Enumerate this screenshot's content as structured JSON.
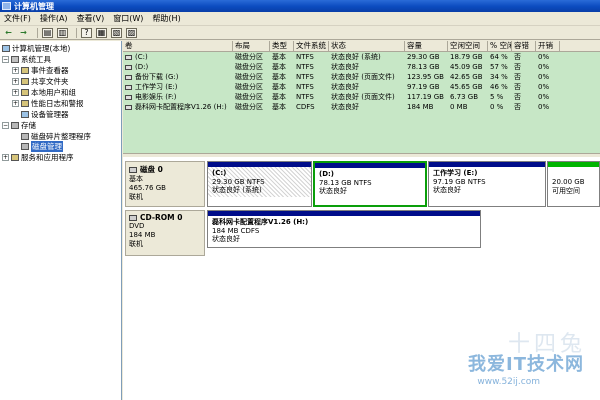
{
  "window": {
    "title": "计算机管理"
  },
  "menu": [
    "文件(F)",
    "操作(A)",
    "查看(V)",
    "窗口(W)",
    "帮助(H)"
  ],
  "tree": {
    "root": "计算机管理(本地)",
    "system_tools": "系统工具",
    "event_viewer": "事件查看器",
    "shared_folders": "共享文件夹",
    "local_users": "本地用户和组",
    "perf_logs": "性能日志和警报",
    "device_manager": "设备管理器",
    "storage": "存储",
    "defrag": "磁盘碎片整理程序",
    "disk_mgmt": "磁盘管理",
    "services": "服务和应用程序"
  },
  "volume_table": {
    "columns": [
      "卷",
      "布局",
      "类型",
      "文件系统",
      "状态",
      "容量",
      "空闲空间",
      "% 空闲",
      "容错",
      "开销"
    ],
    "rows": [
      [
        "(C:)",
        "磁盘分区",
        "基本",
        "NTFS",
        "状态良好 (系统)",
        "29.30 GB",
        "18.79 GB",
        "64 %",
        "否",
        "0%"
      ],
      [
        "(D:)",
        "磁盘分区",
        "基本",
        "NTFS",
        "状态良好",
        "78.13 GB",
        "45.09 GB",
        "57 %",
        "否",
        "0%"
      ],
      [
        "备份下载 (G:)",
        "磁盘分区",
        "基本",
        "NTFS",
        "状态良好 (页面文件)",
        "123.95 GB",
        "42.65 GB",
        "34 %",
        "否",
        "0%"
      ],
      [
        "工作学习 (E:)",
        "磁盘分区",
        "基本",
        "NTFS",
        "状态良好",
        "97.19 GB",
        "45.65 GB",
        "46 %",
        "否",
        "0%"
      ],
      [
        "电影娱乐 (F:)",
        "磁盘分区",
        "基本",
        "NTFS",
        "状态良好 (页面文件)",
        "117.19 GB",
        "6.73 GB",
        "5 %",
        "否",
        "0%"
      ],
      [
        "磊科网卡配置程序V1.26 (H:)",
        "磁盘分区",
        "基本",
        "CDFS",
        "状态良好",
        "184 MB",
        "0 MB",
        "0 %",
        "否",
        "0%"
      ]
    ]
  },
  "disk0": {
    "name": "磁盘 0",
    "type": "基本",
    "size": "465.76 GB",
    "status": "联机",
    "partitions": [
      {
        "name": "(C:)",
        "detail": "29.30 GB NTFS",
        "status": "状态良好 (系统)"
      },
      {
        "name": "(D:)",
        "detail": "78.13 GB NTFS",
        "status": "状态良好"
      },
      {
        "name": "工作学习  (E:)",
        "detail": "97.19 GB NTFS",
        "status": "状态良好"
      },
      {
        "name": "",
        "detail": "20.00 GB",
        "status": "可用空间"
      }
    ]
  },
  "cdrom0": {
    "name": "CD-ROM 0",
    "type": "DVD",
    "size": "184 MB",
    "status": "联机",
    "partition": {
      "name": "磊科网卡配置程序V1.26  (H:)",
      "detail": "184 MB CDFS",
      "status": "状态良好"
    }
  },
  "watermark": {
    "text": "我爱IT技术网",
    "url": "www.52ij.com",
    "big": "十四兔"
  },
  "colors": {
    "primary_bar": "#000d8a",
    "free_bar": "#00b400",
    "volume_bg": "#c7e7c6",
    "selection": "#316ac5"
  }
}
